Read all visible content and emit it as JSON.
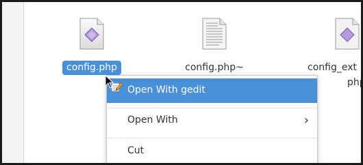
{
  "files": [
    {
      "name": "config.php",
      "icon": "php-file-icon",
      "selected": true
    },
    {
      "name": "config.php~",
      "icon": "text-file-icon",
      "selected": false
    },
    {
      "name": "config_ext",
      "name_line2": "php",
      "icon": "php-file-icon",
      "selected": false
    }
  ],
  "context_menu": {
    "items": [
      {
        "label": "Open With gedit",
        "highlighted": true,
        "icon": "gedit-icon"
      },
      {
        "label": "Open With",
        "submenu_arrow": "›"
      },
      {
        "label": "Cut"
      }
    ]
  },
  "colors": {
    "selection": "#4a90d9",
    "text": "#2e3436",
    "border": "#1a1a1a"
  }
}
